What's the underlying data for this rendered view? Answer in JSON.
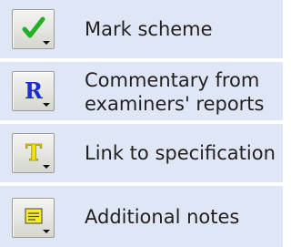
{
  "legend": {
    "items": [
      {
        "label": "Mark scheme",
        "icon": "checkmark-icon",
        "color": "#22b022"
      },
      {
        "label": "Commentary from examiners' reports",
        "icon": "letter-r-icon",
        "color": "#1d2fc9"
      },
      {
        "label": "Link to specification",
        "icon": "letter-t-icon",
        "color": "#f4e400"
      },
      {
        "label": "Additional notes",
        "icon": "note-icon",
        "color": "#f7ec2a"
      }
    ],
    "row_background": "#dfe7f6"
  }
}
